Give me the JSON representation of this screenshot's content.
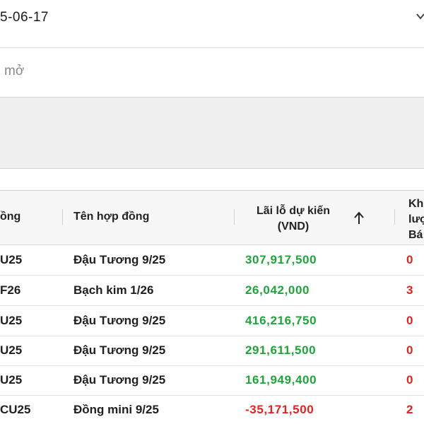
{
  "filters": {
    "date_value": "5-06-17",
    "status_value": "mở"
  },
  "table": {
    "columns": {
      "code": "ồng",
      "name": "Tên hợp đồng",
      "pl_line1": "Lãi lỗ dự kiến",
      "pl_line2": "(VND)",
      "qty_line1": "Kh",
      "qty_line2": "lượ",
      "qty_line3": "Bá"
    },
    "sort_icon": "arrow-up-icon",
    "rows": [
      {
        "code": "U25",
        "name": "Đậu Tương 9/25",
        "pl": "307,917,500",
        "qty": "0",
        "sign": "pos"
      },
      {
        "code": "F26",
        "name": "Bạch kim 1/26",
        "pl": "26,042,000",
        "qty": "3",
        "sign": "pos"
      },
      {
        "code": "U25",
        "name": "Đậu Tương 9/25",
        "pl": "416,216,750",
        "qty": "0",
        "sign": "pos"
      },
      {
        "code": "U25",
        "name": "Đậu Tương 9/25",
        "pl": "291,611,500",
        "qty": "0",
        "sign": "pos"
      },
      {
        "code": "U25",
        "name": "Đậu Tương 9/25",
        "pl": "161,949,400",
        "qty": "0",
        "sign": "pos"
      },
      {
        "code": "CU25",
        "name": "Đồng mini 9/25",
        "pl": "-35,171,500",
        "qty": "2",
        "sign": "neg"
      }
    ]
  },
  "colors": {
    "profit": "#1ea53a",
    "loss": "#e2241c",
    "header_bg": "#f7f7f8",
    "band_bg": "#efeff0"
  }
}
